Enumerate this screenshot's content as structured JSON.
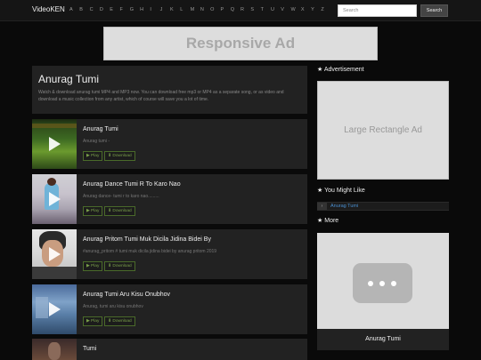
{
  "brand": "VideoKEN",
  "letters": [
    "A",
    "B",
    "C",
    "D",
    "E",
    "F",
    "G",
    "H",
    "I",
    "J",
    "K",
    "L",
    "M",
    "N",
    "O",
    "P",
    "Q",
    "R",
    "S",
    "T",
    "U",
    "V",
    "W",
    "X",
    "Y",
    "Z"
  ],
  "search": {
    "placeholder": "Search",
    "button": "Search"
  },
  "top_ad": "Responsive Ad",
  "header": {
    "title": "Anurag Tumi",
    "description": "Watch & download anurag tumi MP4 and MP3 now. You can download free mp3 or MP4 as a separate song, or as video and download a music collection from any artist, which of course will save you a lot of time."
  },
  "items": [
    {
      "title": "Anurag Tumi",
      "desc": "Anurag tumi -",
      "play": "▶ Play",
      "download": "⬇ Download"
    },
    {
      "title": "Anurag Dance Tumi R To Karo Nao",
      "desc": "Anurag dance- tumi r to karo nao.........",
      "play": "▶ Play",
      "download": "⬇ Download"
    },
    {
      "title": "Anurag Pritom Tumi Muk Dicila Jidina Bidei By",
      "desc": "#anurag_pritom # tumi muk dicila jidina bidei by anurag pritom 2019",
      "play": "▶ Play",
      "download": "⬇ Download"
    },
    {
      "title": "Anurag Tumi Aru Kisu Onubhov",
      "desc": "Anurag, tumi aru kisu onubhov",
      "play": "▶ Play",
      "download": "⬇ Download"
    },
    {
      "title": "Tumi",
      "desc": "",
      "play": "",
      "download": ""
    }
  ],
  "sidebar": {
    "advertisement": "Advertisement",
    "rect_ad": "Large Rectangle Ad",
    "you_might_like": "You Might Like",
    "like_link": "Anurag Tumi",
    "more": "More",
    "more_title": "Anurag Tumi"
  }
}
